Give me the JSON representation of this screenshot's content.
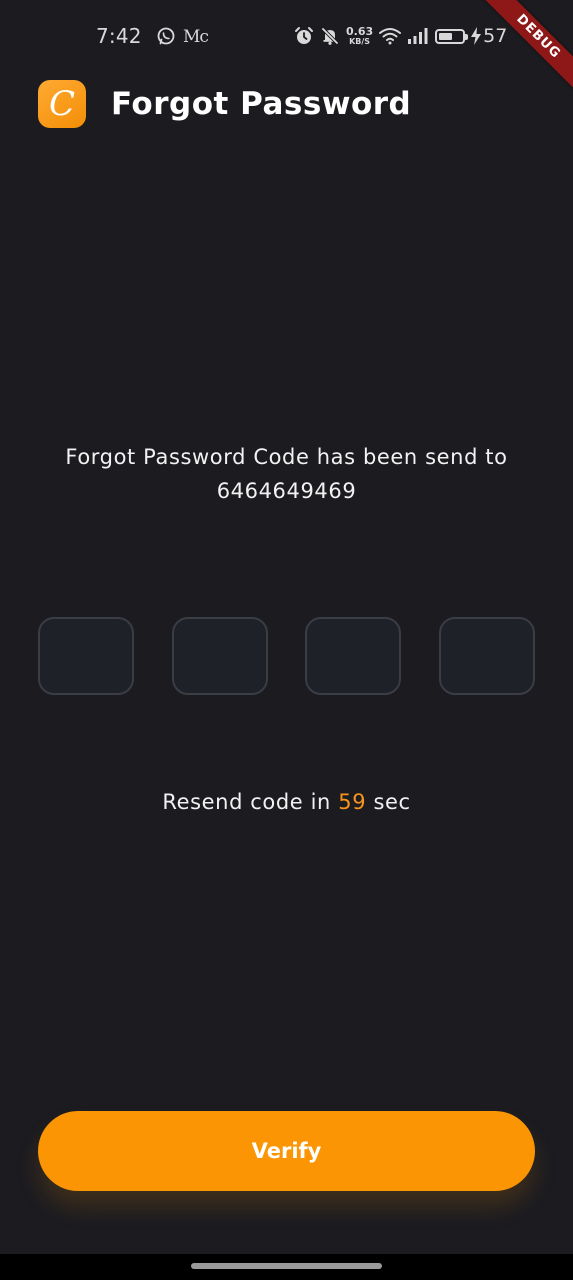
{
  "status_bar": {
    "time": "7:42",
    "app_label": "Mc",
    "network_speed_value": "0.63",
    "network_speed_unit": "KB/S",
    "battery_level": 0.57,
    "battery_percent": "57"
  },
  "debug_banner": "DEBUG",
  "header": {
    "logo_letter": "C",
    "title": "Forgot Password"
  },
  "message": {
    "line1": "Forgot Password Code has been send to",
    "phone": "6464649469"
  },
  "otp": {
    "values": [
      "",
      "",
      "",
      ""
    ]
  },
  "resend": {
    "prefix": "Resend code in",
    "seconds": "59",
    "suffix": "sec"
  },
  "verify_button": {
    "label": "Verify"
  },
  "colors": {
    "background": "#1b1b20",
    "accent": "#fb9503",
    "otp_border": "#3a3d45",
    "debug_ribbon": "#8e1717"
  }
}
